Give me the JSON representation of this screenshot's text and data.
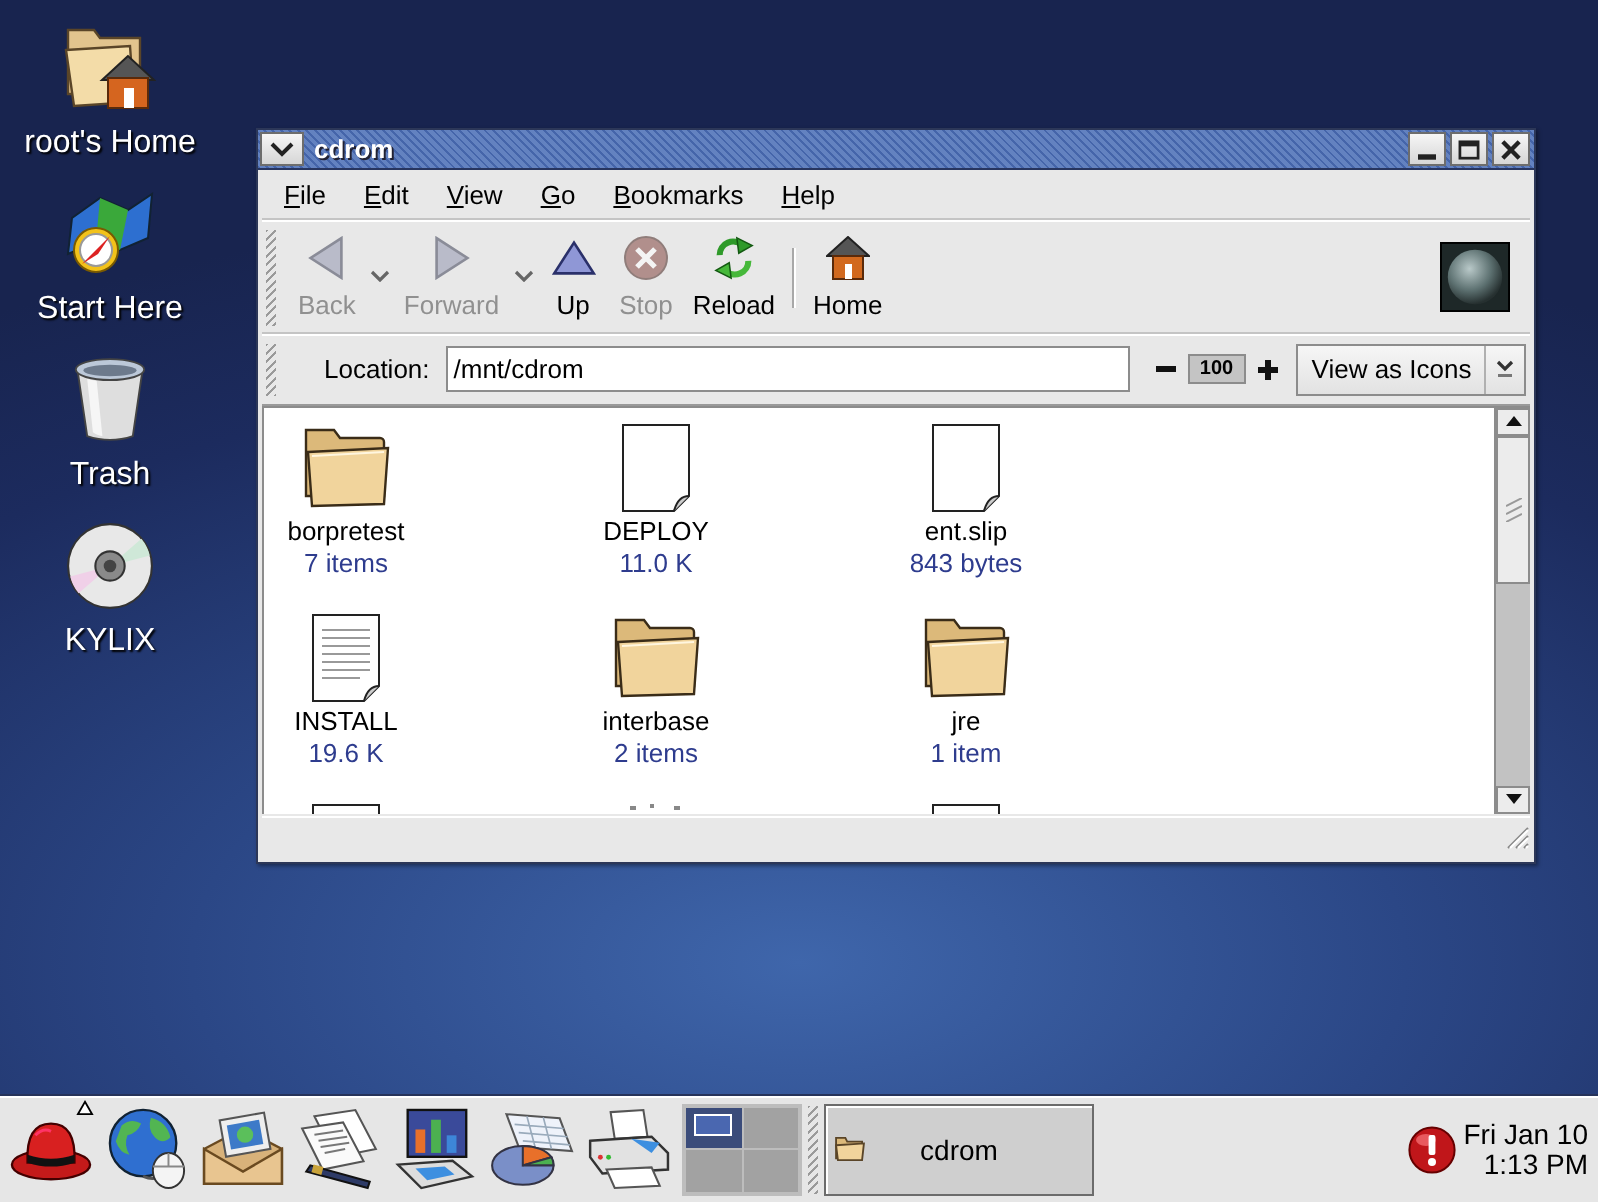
{
  "desktop": {
    "icons": [
      {
        "label": "root's Home",
        "kind": "home"
      },
      {
        "label": "Start Here",
        "kind": "start"
      },
      {
        "label": "Trash",
        "kind": "trash"
      },
      {
        "label": "KYLIX",
        "kind": "disc"
      }
    ]
  },
  "window": {
    "title": "cdrom",
    "menu": [
      "File",
      "Edit",
      "View",
      "Go",
      "Bookmarks",
      "Help"
    ],
    "toolbar": [
      {
        "label": "Back",
        "kind": "back",
        "disabled": true,
        "has_menu": true
      },
      {
        "label": "Forward",
        "kind": "forward",
        "disabled": true,
        "has_menu": true
      },
      {
        "label": "Up",
        "kind": "up",
        "disabled": false,
        "has_menu": false
      },
      {
        "label": "Stop",
        "kind": "stop",
        "disabled": true,
        "has_menu": false
      },
      {
        "label": "Reload",
        "kind": "reload",
        "disabled": false,
        "has_menu": false
      },
      {
        "kind": "separator"
      },
      {
        "label": "Home",
        "kind": "home",
        "disabled": false,
        "has_menu": false
      }
    ],
    "location": {
      "label": "Location:",
      "value": "/mnt/cdrom"
    },
    "zoom": {
      "value": "100"
    },
    "view_selector": {
      "value": "View as Icons"
    },
    "files": [
      {
        "name": "borpretest",
        "info": "7 items",
        "kind": "folder"
      },
      {
        "name": "DEPLOY",
        "info": "11.0 K",
        "kind": "document"
      },
      {
        "name": "ent.slip",
        "info": "843 bytes",
        "kind": "document"
      },
      {
        "name": "INSTALL",
        "info": "19.6 K",
        "kind": "text"
      },
      {
        "name": "interbase",
        "info": "2 items",
        "kind": "folder"
      },
      {
        "name": "jre",
        "info": "1 item",
        "kind": "folder"
      },
      {
        "kind": "text"
      },
      {
        "kind": "misc"
      },
      {
        "kind": "document"
      }
    ]
  },
  "taskbar": {
    "workspaces": [
      {
        "selected": true,
        "has_window": true
      },
      {
        "selected": false,
        "has_window": false
      },
      {
        "selected": false,
        "has_window": false
      },
      {
        "selected": false,
        "has_window": false
      }
    ],
    "tasks": [
      {
        "label": "cdrom"
      }
    ],
    "clock": {
      "date": "Fri Jan 10",
      "time": "1:13 PM"
    }
  }
}
